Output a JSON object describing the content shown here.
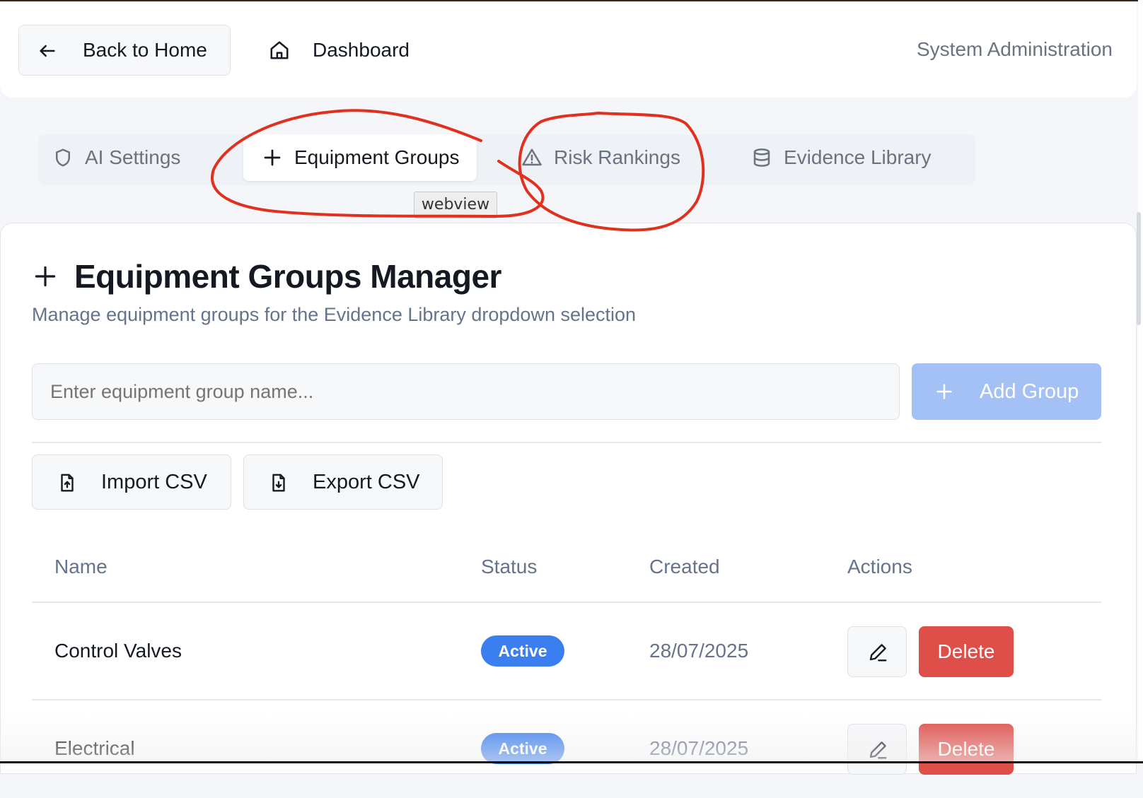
{
  "header": {
    "back_label": "Back to Home",
    "dashboard_label": "Dashboard",
    "context_label": "System Administration"
  },
  "tabs": [
    {
      "label": "AI Settings",
      "icon": "shield-icon"
    },
    {
      "label": "Equipment Groups",
      "icon": "plus-icon",
      "active": true
    },
    {
      "label": "Risk Rankings",
      "icon": "warning-triangle-icon"
    },
    {
      "label": "Evidence Library",
      "icon": "database-icon"
    }
  ],
  "tooltip": "webview",
  "annotation_color": "#e0301e",
  "manager": {
    "title": "Equipment Groups Manager",
    "subtitle": "Manage equipment groups for the Evidence Library dropdown selection",
    "input_placeholder": "Enter equipment group name...",
    "add_label": "Add Group",
    "import_label": "Import CSV",
    "export_label": "Export CSV"
  },
  "table": {
    "columns": [
      "Name",
      "Status",
      "Created",
      "Actions"
    ],
    "rows": [
      {
        "name": "Control Valves",
        "status": "Active",
        "created": "28/07/2025",
        "delete_label": "Delete"
      },
      {
        "name": "Electrical",
        "status": "Active",
        "created": "28/07/2025",
        "delete_label": "Delete"
      }
    ]
  },
  "colors": {
    "accent_blue": "#3b7ef0",
    "add_button_disabled": "#a4c1f5",
    "danger": "#df4f4a"
  }
}
